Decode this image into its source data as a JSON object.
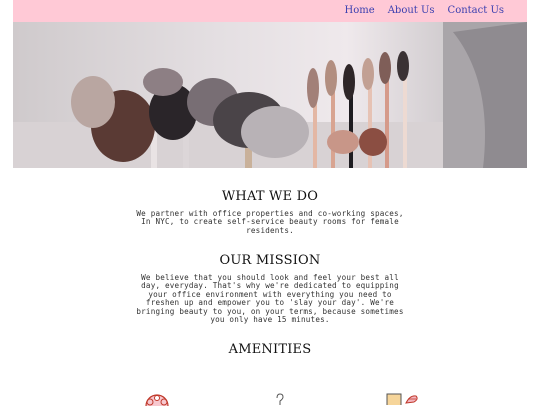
{
  "nav": {
    "home": "Home",
    "about": "About Us",
    "contact": "Contact Us"
  },
  "hero": {
    "image": "makeup-brushes-photo"
  },
  "what_we_do": {
    "heading": "WHAT WE DO",
    "body": "We partner with office properties and co-working spaces, In NYC, to create self-service beauty rooms for female residents."
  },
  "mission": {
    "heading": "OUR MISSION",
    "body": "We believe that you should look and feel your best all day, everyday. That's why we're dedicated to equipping your office environment with everything you need to freshen up and empower you to 'slay your day'. We're bringing beauty to you, on your terms, because sometimes you only have 15 minutes."
  },
  "amenities": {
    "heading": "AMENITIES"
  },
  "colors": {
    "navbar": "#ffc9d6",
    "link": "#3b3fb0"
  },
  "icons": [
    "blush-compact-icon",
    "hair-pin-icon",
    "mirror-brush-icon"
  ]
}
